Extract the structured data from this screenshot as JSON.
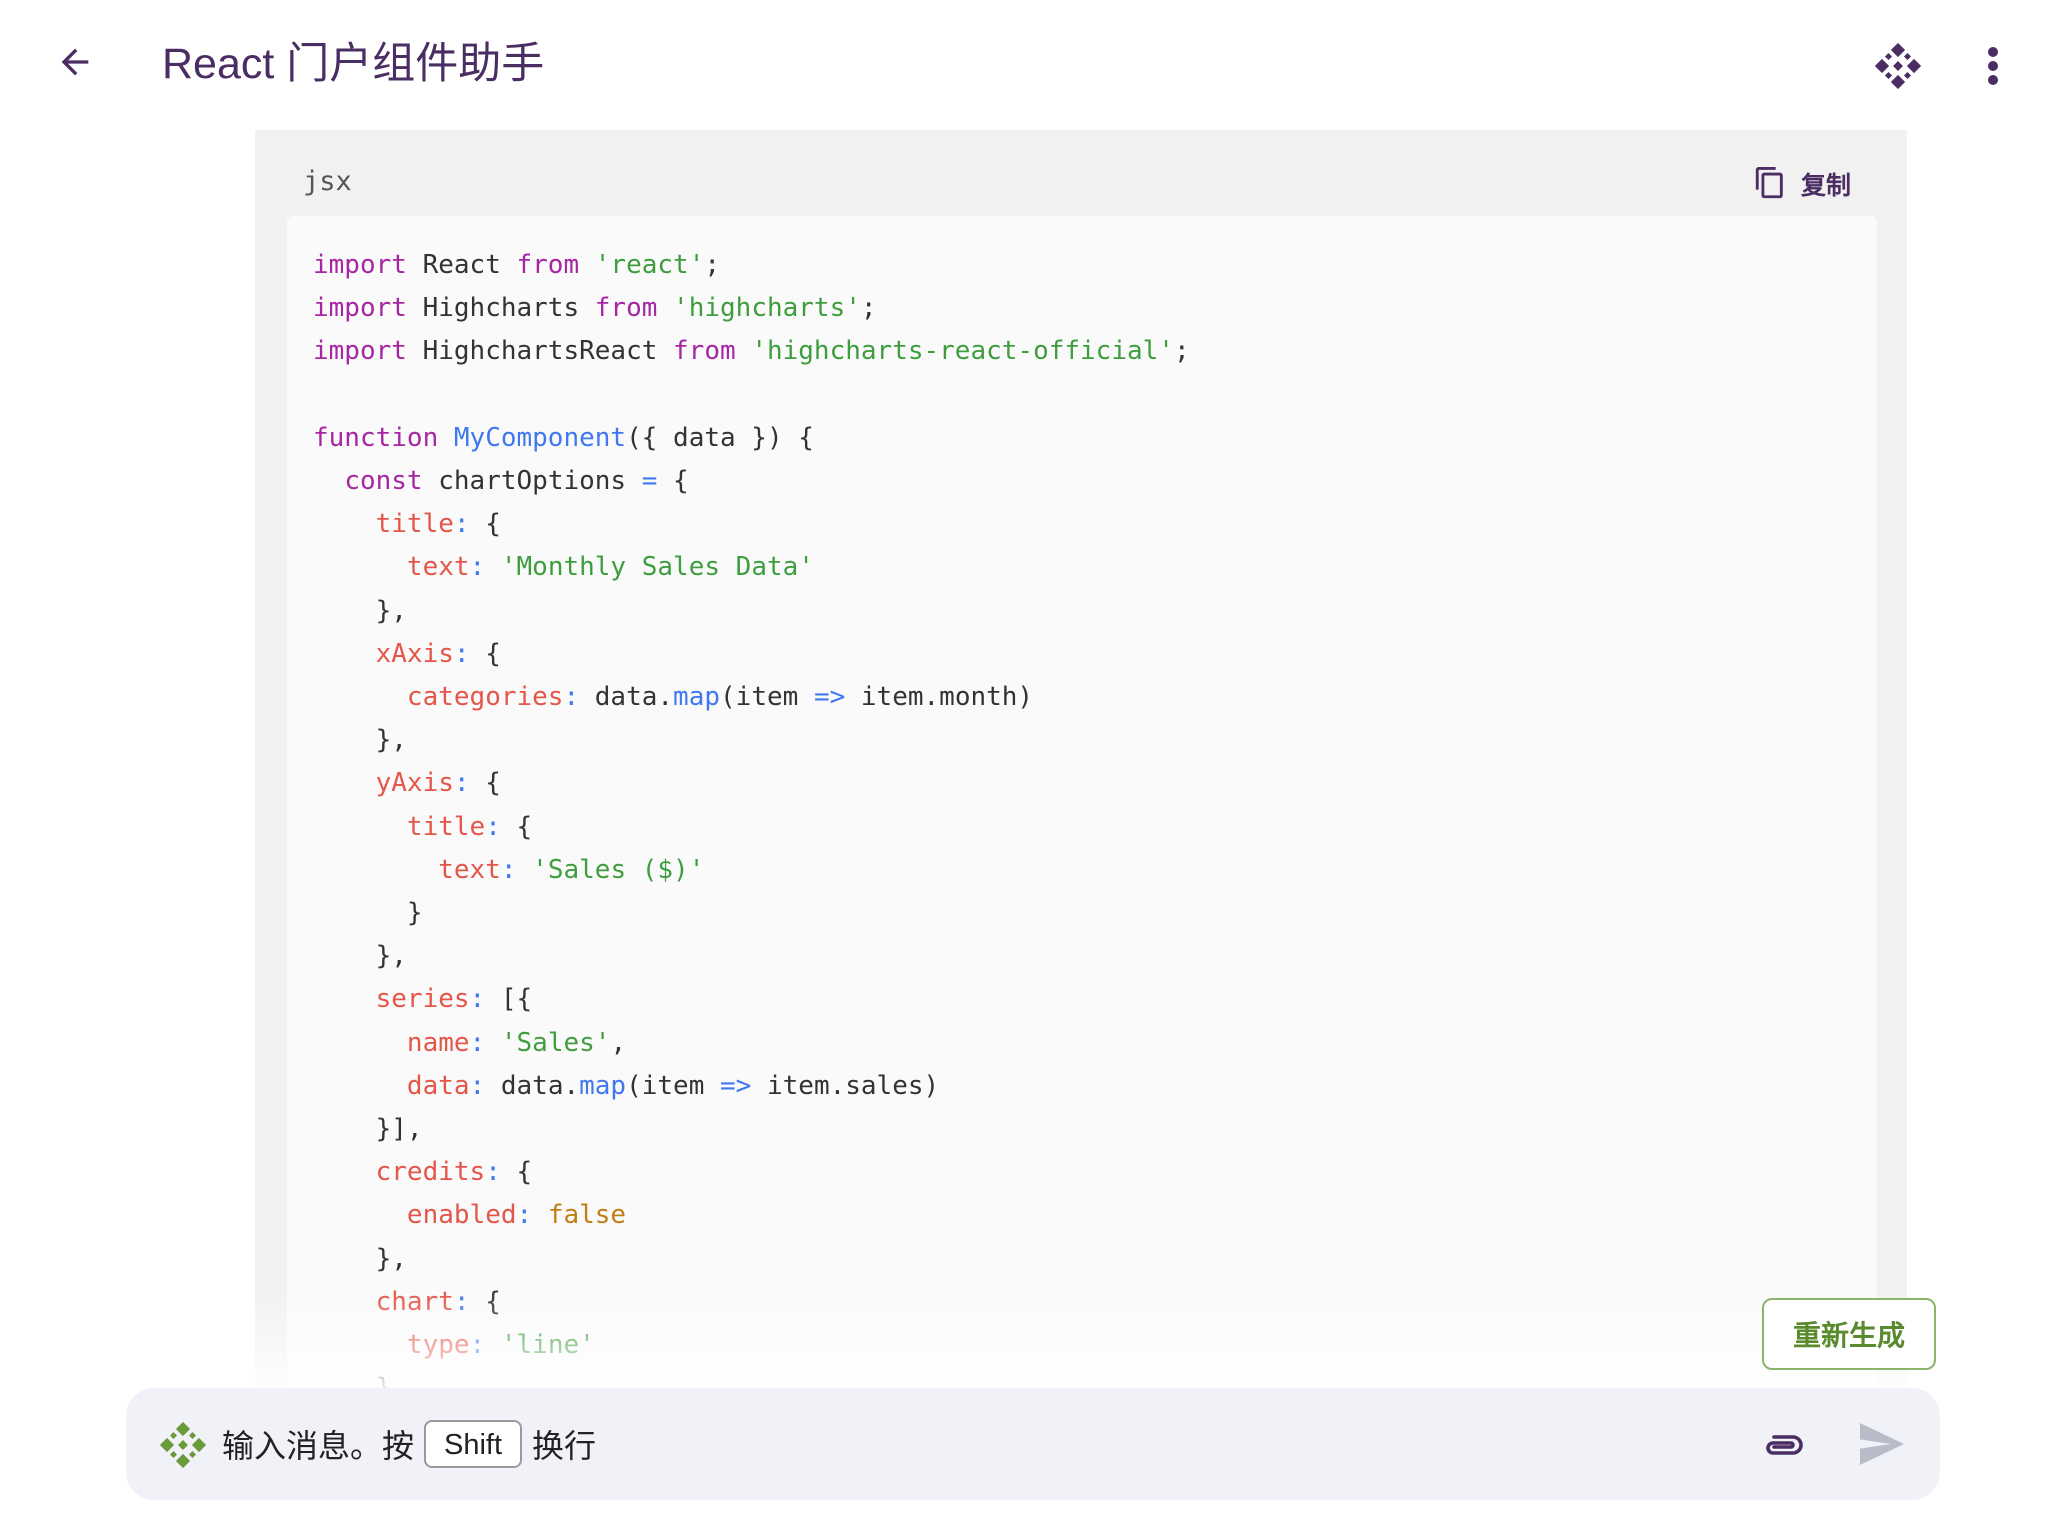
{
  "header": {
    "title": "React 门户组件助手",
    "back_icon": "arrow-left-icon",
    "logo_icon": "diamond-dots-logo-icon",
    "more_icon": "more-vertical-icon"
  },
  "code_block": {
    "language": "jsx",
    "copy_label": "复制",
    "lines": [
      [
        [
          "kw",
          "import"
        ],
        [
          "plain",
          " React "
        ],
        [
          "kw",
          "from"
        ],
        [
          "plain",
          " "
        ],
        [
          "str",
          "'react'"
        ],
        [
          "plain",
          ";"
        ]
      ],
      [
        [
          "kw",
          "import"
        ],
        [
          "plain",
          " Highcharts "
        ],
        [
          "kw",
          "from"
        ],
        [
          "plain",
          " "
        ],
        [
          "str",
          "'highcharts'"
        ],
        [
          "plain",
          ";"
        ]
      ],
      [
        [
          "kw",
          "import"
        ],
        [
          "plain",
          " HighchartsReact "
        ],
        [
          "kw",
          "from"
        ],
        [
          "plain",
          " "
        ],
        [
          "str",
          "'highcharts-react-official'"
        ],
        [
          "plain",
          ";"
        ]
      ],
      [],
      [
        [
          "kw",
          "function"
        ],
        [
          "plain",
          " "
        ],
        [
          "fn",
          "MyComponent"
        ],
        [
          "plain",
          "({ data }) {"
        ]
      ],
      [
        [
          "plain",
          "  "
        ],
        [
          "kw",
          "const"
        ],
        [
          "plain",
          " chartOptions "
        ],
        [
          "op",
          "="
        ],
        [
          "plain",
          " {"
        ]
      ],
      [
        [
          "plain",
          "    "
        ],
        [
          "prop",
          "title"
        ],
        [
          "op",
          ":"
        ],
        [
          "plain",
          " {"
        ]
      ],
      [
        [
          "plain",
          "      "
        ],
        [
          "prop",
          "text"
        ],
        [
          "op",
          ":"
        ],
        [
          "plain",
          " "
        ],
        [
          "str",
          "'Monthly Sales Data'"
        ]
      ],
      [
        [
          "plain",
          "    },"
        ]
      ],
      [
        [
          "plain",
          "    "
        ],
        [
          "prop",
          "xAxis"
        ],
        [
          "op",
          ":"
        ],
        [
          "plain",
          " {"
        ]
      ],
      [
        [
          "plain",
          "      "
        ],
        [
          "prop",
          "categories"
        ],
        [
          "op",
          ":"
        ],
        [
          "plain",
          " data."
        ],
        [
          "fn",
          "map"
        ],
        [
          "plain",
          "(item "
        ],
        [
          "op",
          "=>"
        ],
        [
          "plain",
          " item.month)"
        ]
      ],
      [
        [
          "plain",
          "    },"
        ]
      ],
      [
        [
          "plain",
          "    "
        ],
        [
          "prop",
          "yAxis"
        ],
        [
          "op",
          ":"
        ],
        [
          "plain",
          " {"
        ]
      ],
      [
        [
          "plain",
          "      "
        ],
        [
          "prop",
          "title"
        ],
        [
          "op",
          ":"
        ],
        [
          "plain",
          " {"
        ]
      ],
      [
        [
          "plain",
          "        "
        ],
        [
          "prop",
          "text"
        ],
        [
          "op",
          ":"
        ],
        [
          "plain",
          " "
        ],
        [
          "str",
          "'Sales ($)'"
        ]
      ],
      [
        [
          "plain",
          "      }"
        ]
      ],
      [
        [
          "plain",
          "    },"
        ]
      ],
      [
        [
          "plain",
          "    "
        ],
        [
          "prop",
          "series"
        ],
        [
          "op",
          ":"
        ],
        [
          "plain",
          " [{"
        ]
      ],
      [
        [
          "plain",
          "      "
        ],
        [
          "prop",
          "name"
        ],
        [
          "op",
          ":"
        ],
        [
          "plain",
          " "
        ],
        [
          "str",
          "'Sales'"
        ],
        [
          "plain",
          ","
        ]
      ],
      [
        [
          "plain",
          "      "
        ],
        [
          "prop",
          "data"
        ],
        [
          "op",
          ":"
        ],
        [
          "plain",
          " data."
        ],
        [
          "fn",
          "map"
        ],
        [
          "plain",
          "(item "
        ],
        [
          "op",
          "=>"
        ],
        [
          "plain",
          " item.sales)"
        ]
      ],
      [
        [
          "plain",
          "    }],"
        ]
      ],
      [
        [
          "plain",
          "    "
        ],
        [
          "prop",
          "credits"
        ],
        [
          "op",
          ":"
        ],
        [
          "plain",
          " {"
        ]
      ],
      [
        [
          "plain",
          "      "
        ],
        [
          "prop",
          "enabled"
        ],
        [
          "op",
          ":"
        ],
        [
          "plain",
          " "
        ],
        [
          "bool",
          "false"
        ]
      ],
      [
        [
          "plain",
          "    },"
        ]
      ],
      [
        [
          "plain",
          "    "
        ],
        [
          "prop",
          "chart"
        ],
        [
          "op",
          ":"
        ],
        [
          "plain",
          " {"
        ]
      ],
      [
        [
          "plain",
          "      "
        ],
        [
          "prop",
          "type"
        ],
        [
          "op",
          ":"
        ],
        [
          "plain",
          " "
        ],
        [
          "str",
          "'line'"
        ]
      ],
      [
        [
          "plain",
          "    },"
        ]
      ]
    ]
  },
  "regenerate_label": "重新生成",
  "input": {
    "placeholder_before": "输入消息。按",
    "key_label": "Shift",
    "placeholder_after": "换行",
    "attach_icon": "paperclip-icon",
    "send_icon": "send-icon"
  },
  "colors": {
    "title": "#4a2d63",
    "logo_purple": "#4a2d63",
    "logo_green": "#6b9a3a",
    "regenerate_border": "#8db36b",
    "regenerate_text": "#5a8a2e"
  }
}
